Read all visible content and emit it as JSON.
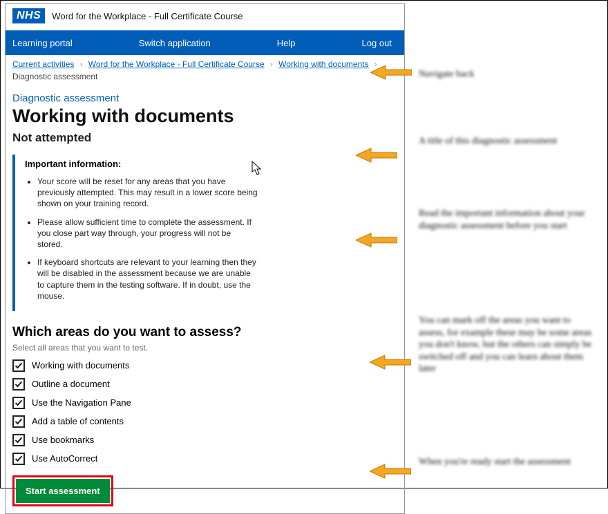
{
  "header": {
    "logo_text": "NHS",
    "course_title": "Word for the Workplace - Full Certificate Course"
  },
  "nav": {
    "items": [
      "Learning portal",
      "Switch application",
      "Help",
      "Log out"
    ]
  },
  "breadcrumbs": {
    "links": [
      "Current activities",
      "Word for the Workplace - Full Certificate Course",
      "Working with documents"
    ],
    "current": "Diagnostic assessment"
  },
  "page": {
    "kicker": "Diagnostic assessment",
    "title": "Working with documents",
    "status": "Not attempted"
  },
  "info": {
    "heading": "Important information:",
    "bullets": [
      "Your score will be reset for any areas that you have previously attempted. This may result in a lower score being shown on your training record.",
      "Please allow sufficient time to complete the assessment. If you close part way through, your progress will not be stored.",
      "If keyboard shortcuts are relevant to your learning then they will be disabled in the assessment because we are unable to capture them in the testing software. If in doubt, use the mouse."
    ]
  },
  "areas": {
    "heading": "Which areas do you want to assess?",
    "hint": "Select all areas that you want to test.",
    "items": [
      {
        "label": "Working with documents",
        "checked": true
      },
      {
        "label": "Outline a document",
        "checked": true
      },
      {
        "label": "Use the Navigation Pane",
        "checked": true
      },
      {
        "label": "Add a table of contents",
        "checked": true
      },
      {
        "label": "Use bookmarks",
        "checked": true
      },
      {
        "label": "Use AutoCorrect",
        "checked": true
      }
    ]
  },
  "actions": {
    "start_label": "Start assessment"
  },
  "annotations": [
    {
      "text": "Navigate back"
    },
    {
      "text": "A title of this diagnostic assessment"
    },
    {
      "text": "Read the important information about your diagnostic assessment before you start"
    },
    {
      "text": "You can mark off the areas you want to assess, for example these may be some areas you don't know, but the others can simply be switched off and you can learn about them later"
    },
    {
      "text": "When you're ready start the assessment"
    }
  ]
}
